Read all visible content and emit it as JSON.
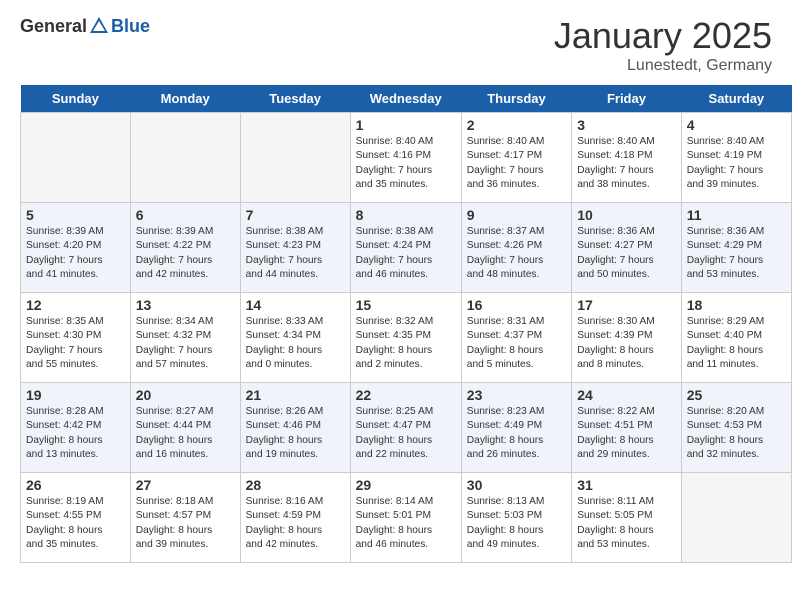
{
  "header": {
    "logo_general": "General",
    "logo_blue": "Blue",
    "month_year": "January 2025",
    "location": "Lunestedt, Germany"
  },
  "days_of_week": [
    "Sunday",
    "Monday",
    "Tuesday",
    "Wednesday",
    "Thursday",
    "Friday",
    "Saturday"
  ],
  "weeks": [
    [
      {
        "num": "",
        "empty": true
      },
      {
        "num": "",
        "empty": true
      },
      {
        "num": "",
        "empty": true
      },
      {
        "num": "1",
        "sunrise": "8:40 AM",
        "sunset": "4:16 PM",
        "daylight": "7 hours and 35 minutes."
      },
      {
        "num": "2",
        "sunrise": "8:40 AM",
        "sunset": "4:17 PM",
        "daylight": "7 hours and 36 minutes."
      },
      {
        "num": "3",
        "sunrise": "8:40 AM",
        "sunset": "4:18 PM",
        "daylight": "7 hours and 38 minutes."
      },
      {
        "num": "4",
        "sunrise": "8:40 AM",
        "sunset": "4:19 PM",
        "daylight": "7 hours and 39 minutes."
      }
    ],
    [
      {
        "num": "5",
        "sunrise": "8:39 AM",
        "sunset": "4:20 PM",
        "daylight": "7 hours and 41 minutes."
      },
      {
        "num": "6",
        "sunrise": "8:39 AM",
        "sunset": "4:22 PM",
        "daylight": "7 hours and 42 minutes."
      },
      {
        "num": "7",
        "sunrise": "8:38 AM",
        "sunset": "4:23 PM",
        "daylight": "7 hours and 44 minutes."
      },
      {
        "num": "8",
        "sunrise": "8:38 AM",
        "sunset": "4:24 PM",
        "daylight": "7 hours and 46 minutes."
      },
      {
        "num": "9",
        "sunrise": "8:37 AM",
        "sunset": "4:26 PM",
        "daylight": "7 hours and 48 minutes."
      },
      {
        "num": "10",
        "sunrise": "8:36 AM",
        "sunset": "4:27 PM",
        "daylight": "7 hours and 50 minutes."
      },
      {
        "num": "11",
        "sunrise": "8:36 AM",
        "sunset": "4:29 PM",
        "daylight": "7 hours and 53 minutes."
      }
    ],
    [
      {
        "num": "12",
        "sunrise": "8:35 AM",
        "sunset": "4:30 PM",
        "daylight": "7 hours and 55 minutes."
      },
      {
        "num": "13",
        "sunrise": "8:34 AM",
        "sunset": "4:32 PM",
        "daylight": "7 hours and 57 minutes."
      },
      {
        "num": "14",
        "sunrise": "8:33 AM",
        "sunset": "4:34 PM",
        "daylight": "8 hours and 0 minutes."
      },
      {
        "num": "15",
        "sunrise": "8:32 AM",
        "sunset": "4:35 PM",
        "daylight": "8 hours and 2 minutes."
      },
      {
        "num": "16",
        "sunrise": "8:31 AM",
        "sunset": "4:37 PM",
        "daylight": "8 hours and 5 minutes."
      },
      {
        "num": "17",
        "sunrise": "8:30 AM",
        "sunset": "4:39 PM",
        "daylight": "8 hours and 8 minutes."
      },
      {
        "num": "18",
        "sunrise": "8:29 AM",
        "sunset": "4:40 PM",
        "daylight": "8 hours and 11 minutes."
      }
    ],
    [
      {
        "num": "19",
        "sunrise": "8:28 AM",
        "sunset": "4:42 PM",
        "daylight": "8 hours and 13 minutes."
      },
      {
        "num": "20",
        "sunrise": "8:27 AM",
        "sunset": "4:44 PM",
        "daylight": "8 hours and 16 minutes."
      },
      {
        "num": "21",
        "sunrise": "8:26 AM",
        "sunset": "4:46 PM",
        "daylight": "8 hours and 19 minutes."
      },
      {
        "num": "22",
        "sunrise": "8:25 AM",
        "sunset": "4:47 PM",
        "daylight": "8 hours and 22 minutes."
      },
      {
        "num": "23",
        "sunrise": "8:23 AM",
        "sunset": "4:49 PM",
        "daylight": "8 hours and 26 minutes."
      },
      {
        "num": "24",
        "sunrise": "8:22 AM",
        "sunset": "4:51 PM",
        "daylight": "8 hours and 29 minutes."
      },
      {
        "num": "25",
        "sunrise": "8:20 AM",
        "sunset": "4:53 PM",
        "daylight": "8 hours and 32 minutes."
      }
    ],
    [
      {
        "num": "26",
        "sunrise": "8:19 AM",
        "sunset": "4:55 PM",
        "daylight": "8 hours and 35 minutes."
      },
      {
        "num": "27",
        "sunrise": "8:18 AM",
        "sunset": "4:57 PM",
        "daylight": "8 hours and 39 minutes."
      },
      {
        "num": "28",
        "sunrise": "8:16 AM",
        "sunset": "4:59 PM",
        "daylight": "8 hours and 42 minutes."
      },
      {
        "num": "29",
        "sunrise": "8:14 AM",
        "sunset": "5:01 PM",
        "daylight": "8 hours and 46 minutes."
      },
      {
        "num": "30",
        "sunrise": "8:13 AM",
        "sunset": "5:03 PM",
        "daylight": "8 hours and 49 minutes."
      },
      {
        "num": "31",
        "sunrise": "8:11 AM",
        "sunset": "5:05 PM",
        "daylight": "8 hours and 53 minutes."
      },
      {
        "num": "",
        "empty": true
      }
    ]
  ]
}
